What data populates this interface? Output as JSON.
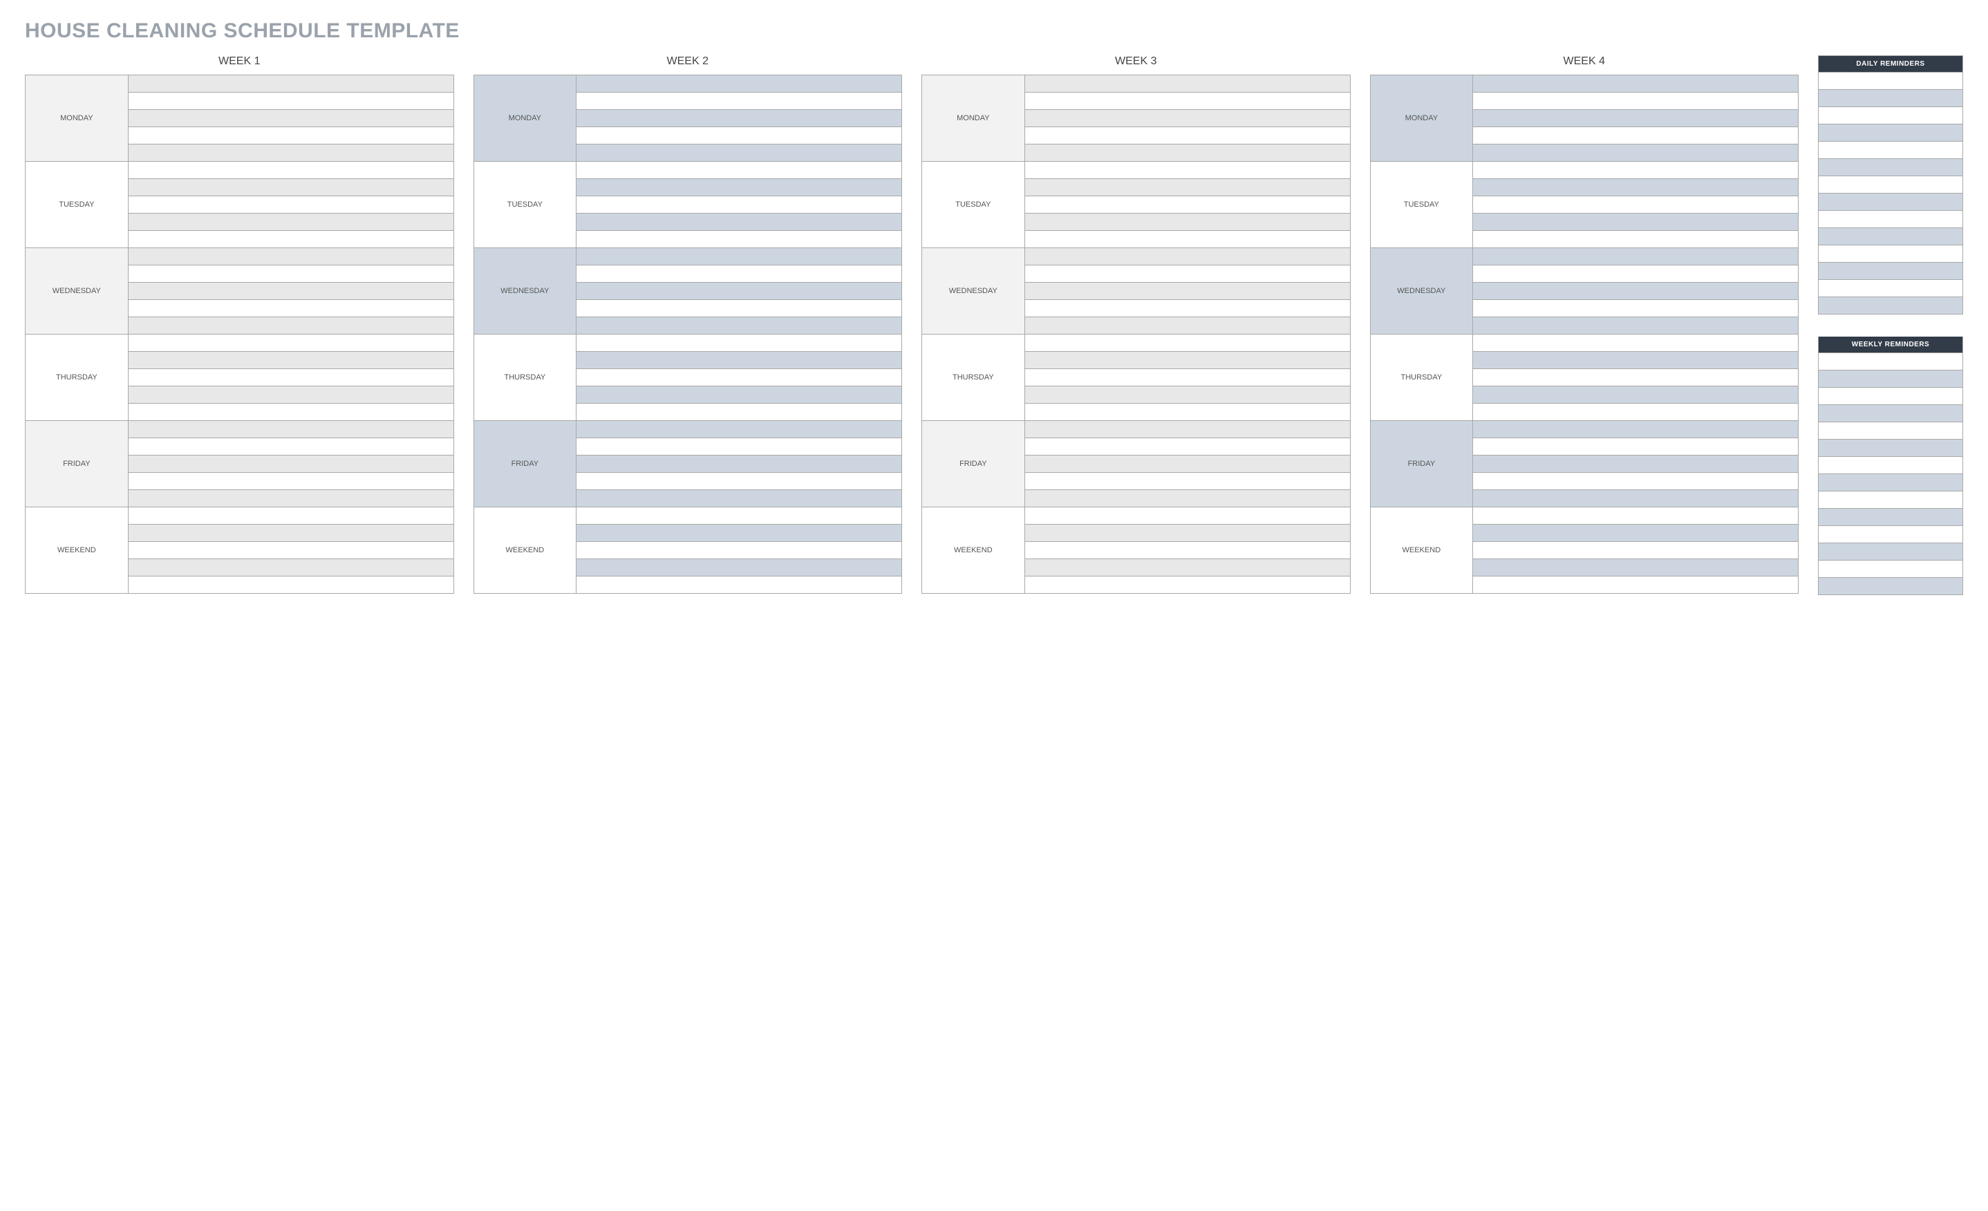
{
  "title": "HOUSE CLEANING SCHEDULE TEMPLATE",
  "weeks": [
    {
      "label": "WEEK 1"
    },
    {
      "label": "WEEK 2"
    },
    {
      "label": "WEEK 3"
    },
    {
      "label": "WEEK 4"
    }
  ],
  "days": [
    {
      "label": "MONDAY",
      "variant": "grey"
    },
    {
      "label": "TUESDAY",
      "variant": "white"
    },
    {
      "label": "WEDNESDAY",
      "variant": "grey"
    },
    {
      "label": "THURSDAY",
      "variant": "white"
    },
    {
      "label": "FRIDAY",
      "variant": "grey"
    },
    {
      "label": "WEEKEND",
      "variant": "white"
    }
  ],
  "rows_per_day": 5,
  "sidebar": {
    "daily": {
      "header": "DAILY REMINDERS",
      "rows": 14
    },
    "weekly": {
      "header": "WEEKLY REMINDERS",
      "rows": 14
    }
  },
  "colors": {
    "title": "#9aa2ab",
    "blue_fill": "#cdd6e0",
    "grey_fill": "#e8e8e8",
    "light_fill": "#f2f2f2",
    "dark_header": "#323b48"
  }
}
